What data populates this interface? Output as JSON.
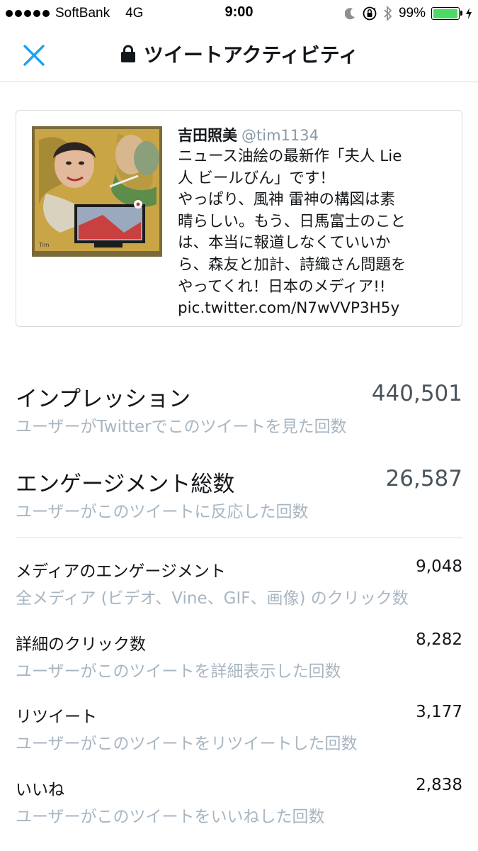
{
  "status_bar": {
    "carrier": "SoftBank",
    "network": "4G",
    "time": "9:00",
    "battery_percent": "99%",
    "battery_level": 0.99,
    "icons": [
      "moon-icon",
      "orientation-lock-icon",
      "bluetooth-icon",
      "battery-icon",
      "charging-icon"
    ]
  },
  "nav": {
    "title": "ツイートアクティビティ",
    "close_icon": "close-icon",
    "lock_icon": "lock-icon"
  },
  "tweet": {
    "author_name": "吉田照美",
    "author_handle": "@tim1134",
    "text": "ニュース油絵の最新作「夫人 Lie\n人 ビールびん」です！\nやっぱり、風神 雷神の構図は素\n晴らしい。もう、日馬富士のこと\nは、本当に報道しなくていいか\nら、森友と加計、詩織さん問題を\nやってくれ！日本のメディア!!\npic.twitter.com/N7wVVP3H5y"
  },
  "metrics": {
    "impressions": {
      "label": "インプレッション",
      "value": "440,501",
      "sub": "ユーザーがTwitterでこのツイートを見た回数"
    },
    "engagements": {
      "label": "エンゲージメント総数",
      "value": "26,587",
      "sub": "ユーザーがこのツイートに反応した回数"
    },
    "media": {
      "label": "メディアのエンゲージメント",
      "value": "9,048",
      "sub": "全メディア (ビデオ、Vine、GIF、画像) のクリック数"
    },
    "details": {
      "label": "詳細のクリック数",
      "value": "8,282",
      "sub": "ユーザーがこのツイートを詳細表示した回数"
    },
    "retweets": {
      "label": "リツイート",
      "value": "3,177",
      "sub": "ユーザーがこのツイートをリツイートした回数"
    },
    "likes": {
      "label": "いいね",
      "value": "2,838",
      "sub": "ユーザーがこのツイートをいいねした回数"
    }
  },
  "colors": {
    "accent": "#1da1f2",
    "text": "#14171a",
    "secondary": "#a8b6c2",
    "border": "#d6dbe0",
    "battery": "#4cd964"
  }
}
